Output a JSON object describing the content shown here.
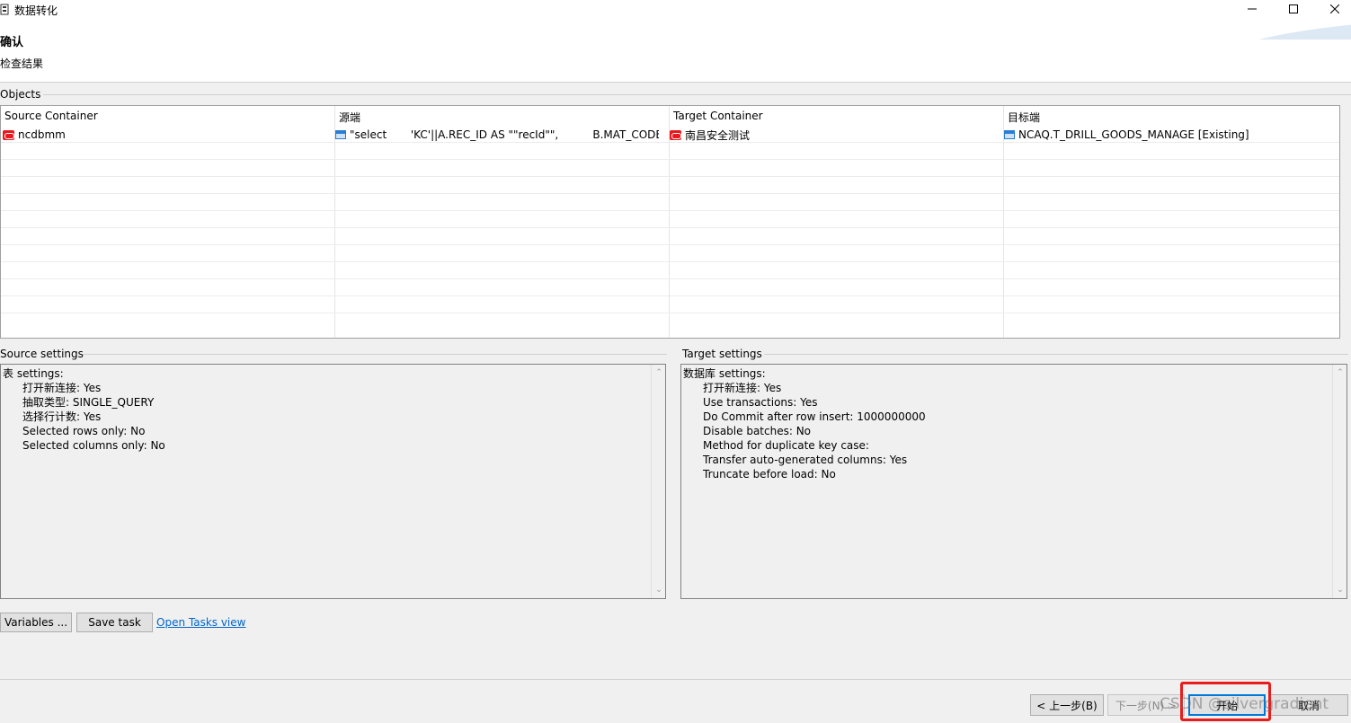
{
  "window": {
    "title": "数据转化"
  },
  "header": {
    "title": "确认",
    "subtitle": "检查结果"
  },
  "objects": {
    "label": "Objects",
    "columns": [
      "Source Container",
      "源端",
      "Target Container",
      "目标端"
    ],
    "rows": [
      {
        "source_container": "ncdbmm",
        "source": "\"select       'KC'||A.REC_ID AS \"\"recId\"\",          B.MAT_CODE ...",
        "target_container": "南昌安全测试",
        "target": "NCAQ.T_DRILL_GOODS_MANAGE [Existing]"
      }
    ]
  },
  "source_settings": {
    "label": "Source settings",
    "heading": "表 settings:",
    "lines": [
      "打开新连接: Yes",
      "抽取类型: SINGLE_QUERY",
      "选择行计数: Yes",
      "Selected rows only: No",
      "Selected columns only: No"
    ]
  },
  "target_settings": {
    "label": "Target settings",
    "heading": "数据库 settings:",
    "lines": [
      "打开新连接: Yes",
      "Use transactions: Yes",
      "Do Commit after row insert: 1000000000",
      "Disable batches: No",
      "Method for duplicate key case:",
      "Transfer auto-generated columns: Yes",
      "Truncate before load: No"
    ]
  },
  "toolbar": {
    "variables_label": "Variables ...",
    "save_task_label": "Save task",
    "open_tasks_label": "Open Tasks view"
  },
  "footer": {
    "back_label": "< 上一步(B)",
    "next_label": "下一步(N) >",
    "start_label": "开始",
    "cancel_label": "取消"
  },
  "watermark": "CSDN @silvergradient",
  "colors": {
    "link": "#0066cc",
    "highlight": "#e81c1c",
    "default_button_border": "#0078d7"
  }
}
